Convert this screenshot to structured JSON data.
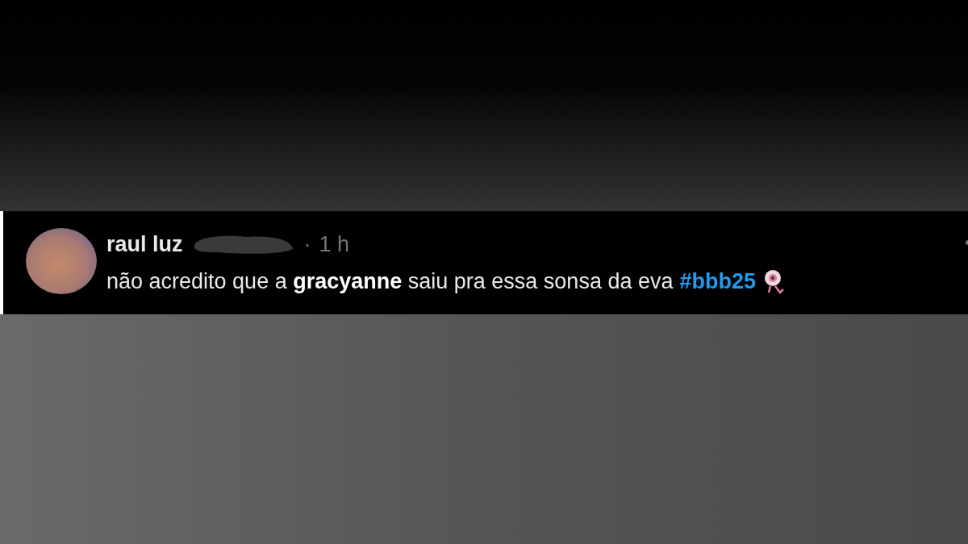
{
  "tweet": {
    "author": "raul luz",
    "separator": "·",
    "time": "1 h",
    "text": "não acredito que a **gracyanne** saiu pra essa sonsa da eva",
    "hashtag": "#bbb25"
  }
}
